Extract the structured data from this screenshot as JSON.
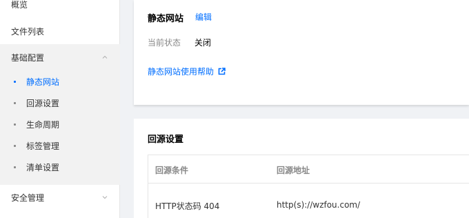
{
  "sidebar": {
    "overview": "概览",
    "file_list": "文件列表",
    "basic_config": {
      "label": "基础配置",
      "items": [
        {
          "label": "静态网站",
          "active": true
        },
        {
          "label": "回源设置",
          "active": false
        },
        {
          "label": "生命周期",
          "active": false
        },
        {
          "label": "标签管理",
          "active": false
        },
        {
          "label": "清单设置",
          "active": false
        }
      ]
    },
    "security": "安全管理",
    "icons": [
      "chevron-up-icon",
      "chevron-down-icon"
    ]
  },
  "static_site": {
    "title": "静态网站",
    "edit": "编辑",
    "status_label": "当前状态",
    "status_value": "关闭",
    "help_link": "静态网站使用帮助"
  },
  "origin": {
    "title": "回源设置",
    "columns": [
      "回源条件",
      "回源地址"
    ],
    "rows": [
      {
        "condition": "HTTP状态码 404",
        "address": "http(s)://wzfou.com/"
      }
    ]
  },
  "colors": {
    "accent": "#006eff",
    "background": "#f0f2f5",
    "sidebar_group_bg": "#f2f2f2"
  }
}
